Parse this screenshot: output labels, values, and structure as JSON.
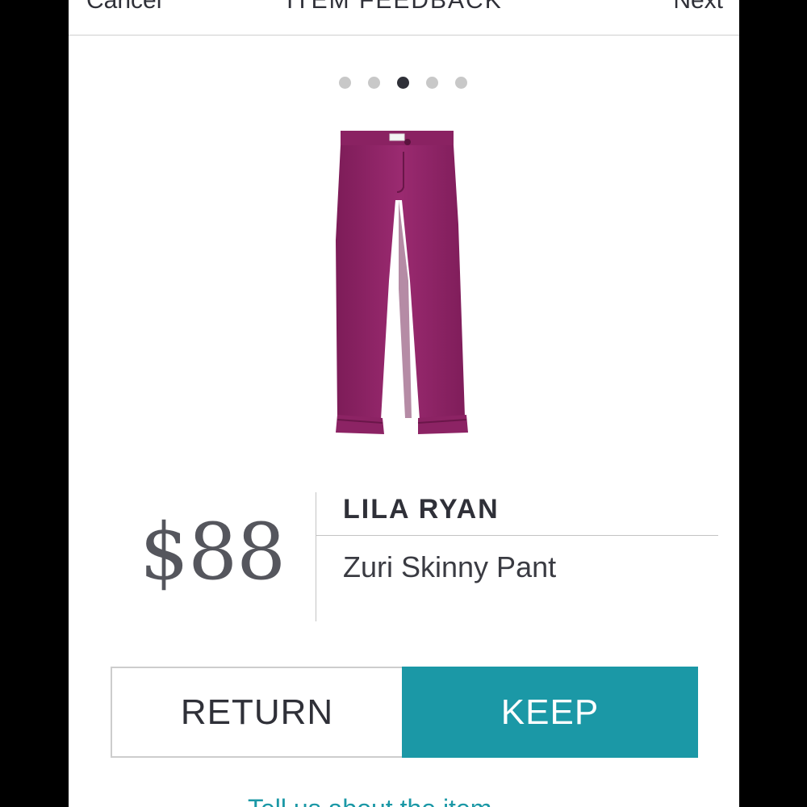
{
  "header": {
    "left_label": "Cancel",
    "center_title": "ITEM FEEDBACK",
    "right_label": "Next"
  },
  "carousel": {
    "total": 5,
    "active_index": 3
  },
  "product": {
    "image_icon": "purple-pants-image",
    "price": "$88",
    "brand": "LILA RYAN",
    "name": "Zuri Skinny Pant"
  },
  "actions": {
    "return_label": "RETURN",
    "keep_label": "KEEP"
  },
  "footer": {
    "link_text": "Tell us about the item"
  },
  "colors": {
    "accent": "#1b98a6",
    "text_dark": "#2f3038",
    "pants": "#8f2466"
  }
}
